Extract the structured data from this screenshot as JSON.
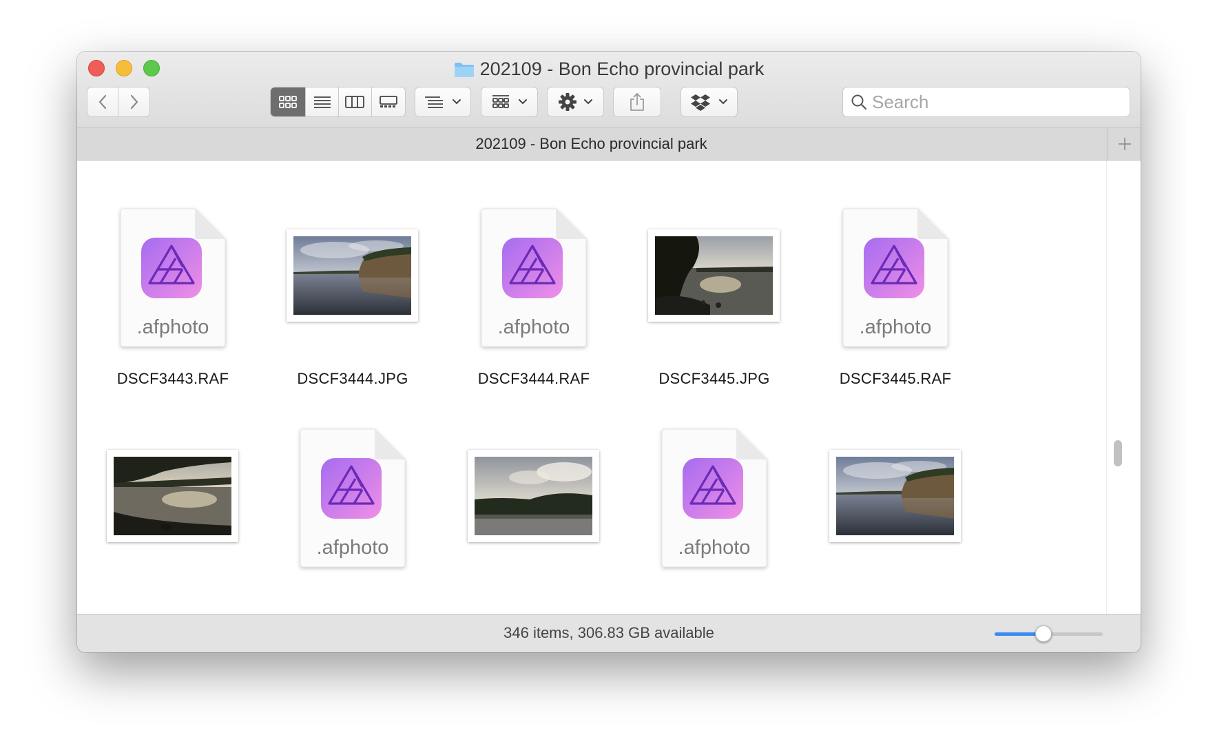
{
  "window": {
    "title": "202109 - Bon Echo provincial park"
  },
  "toolbar": {
    "view_modes": [
      {
        "name": "icon-view",
        "active": true
      },
      {
        "name": "list-view",
        "active": false
      },
      {
        "name": "column-view",
        "active": false
      },
      {
        "name": "gallery-view",
        "active": false
      }
    ],
    "search_placeholder": "Search"
  },
  "tab": {
    "label": "202109 - Bon Echo provincial park"
  },
  "files": [
    {
      "name": "DSCF3443.RAF",
      "kind": "afphoto",
      "ext": ".afphoto"
    },
    {
      "name": "DSCF3444.JPG",
      "kind": "photo",
      "scene": "cliff-lake"
    },
    {
      "name": "DSCF3444.RAF",
      "kind": "afphoto",
      "ext": ".afphoto"
    },
    {
      "name": "DSCF3445.JPG",
      "kind": "photo",
      "scene": "dark-shore"
    },
    {
      "name": "DSCF3445.RAF",
      "kind": "afphoto",
      "ext": ".afphoto"
    },
    {
      "name": "",
      "kind": "photo",
      "scene": "sunset-shore"
    },
    {
      "name": "",
      "kind": "afphoto",
      "ext": ".afphoto"
    },
    {
      "name": "",
      "kind": "photo",
      "scene": "cloudy-lake"
    },
    {
      "name": "",
      "kind": "afphoto",
      "ext": ".afphoto"
    },
    {
      "name": "",
      "kind": "photo",
      "scene": "cliff-lake-2"
    }
  ],
  "status": {
    "text": "346 items, 306.83 GB available",
    "icon_size_fraction": 0.45
  },
  "colors": {
    "accent": "#3d8bf2",
    "afphoto_grad_top": "#a66cf0",
    "afphoto_grad_bottom": "#f08fe6"
  }
}
